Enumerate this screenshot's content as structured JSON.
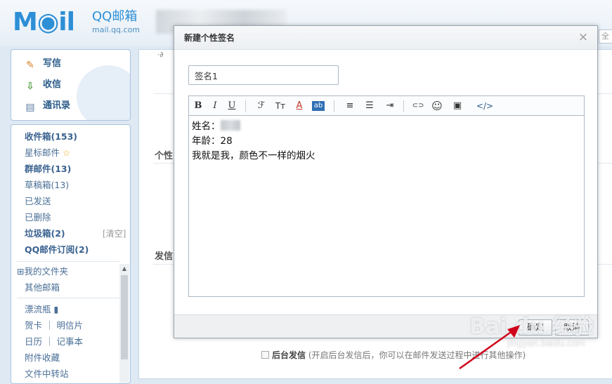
{
  "header": {
    "logo_text": "M◉il",
    "brand": "QQ邮箱",
    "domain": "mail.qq.com",
    "search_stub": "全"
  },
  "sidebar": {
    "quick_actions": [
      {
        "label": "写信",
        "icon": "pencil-icon"
      },
      {
        "label": "收信",
        "icon": "inbox-download-icon"
      },
      {
        "label": "通讯录",
        "icon": "contacts-icon"
      }
    ],
    "folders": [
      {
        "label": "收件箱(153)",
        "bold": true
      },
      {
        "label": "星标邮件",
        "bold": false,
        "star": "☆"
      },
      {
        "label": "群邮件(13)",
        "bold": true
      },
      {
        "label": "草稿箱(13)",
        "bold": false
      },
      {
        "label": "已发送",
        "bold": false
      },
      {
        "label": "已删除",
        "bold": false
      },
      {
        "label": "垃圾箱(2)",
        "bold": true,
        "action": "[清空]"
      },
      {
        "label": "QQ邮件订阅(2)",
        "bold": true
      }
    ],
    "my_folders": "⊞我的文件夹",
    "other_mailbox": "其他邮箱",
    "extras": [
      {
        "label": "漂流瓶 ▮"
      },
      {
        "label": "贺卡 ｜ 明信片"
      },
      {
        "label": "日历 ｜ 记事本"
      },
      {
        "label": "附件收藏"
      },
      {
        "label": "文件中转站"
      }
    ]
  },
  "background": {
    "section_signature": "个性",
    "section_send": "发信",
    "checkbox_label": "后台发信",
    "checkbox_note": "(开启后台发信后，你可以在邮件发送过程中进行其他操作)",
    "corner_text": "·∂"
  },
  "dialog": {
    "title": "新建个性签名",
    "close_glyph": "×",
    "name_value": "签名1",
    "toolbar": [
      {
        "name": "bold-button",
        "glyph": "B",
        "cls": "b"
      },
      {
        "name": "italic-button",
        "glyph": "I",
        "cls": "i"
      },
      {
        "name": "underline-button",
        "glyph": "U",
        "cls": "u"
      },
      {
        "name": "font-family-button",
        "glyph": "ℱ"
      },
      {
        "name": "font-size-button",
        "glyph": "Tт"
      },
      {
        "name": "font-color-button",
        "glyph": "A"
      },
      {
        "name": "background-color-button",
        "glyph": "ab"
      },
      {
        "name": "align-button",
        "glyph": "≡"
      },
      {
        "name": "list-button",
        "glyph": "☰"
      },
      {
        "name": "indent-button",
        "glyph": "⇥"
      },
      {
        "name": "link-button",
        "glyph": "⊂⊃"
      },
      {
        "name": "emoji-button",
        "glyph": "☺"
      },
      {
        "name": "image-button",
        "glyph": "▣"
      },
      {
        "name": "source-code-button",
        "glyph": "</>"
      }
    ],
    "body_lines": [
      {
        "prefix": "姓名：",
        "blurred": true
      },
      {
        "prefix": "年龄：28",
        "blurred": false
      },
      {
        "prefix": "我就是我，颜色不一样的烟火",
        "blurred": false
      }
    ],
    "ok_label": "确定",
    "cancel_label": "取消"
  },
  "watermark": {
    "text": "Bai du 经验",
    "sub": "jingyan.baidu.com"
  },
  "colors": {
    "accent": "#2d8fd6",
    "folder_link": "#4a6f97",
    "arrow": "#d0021b"
  }
}
